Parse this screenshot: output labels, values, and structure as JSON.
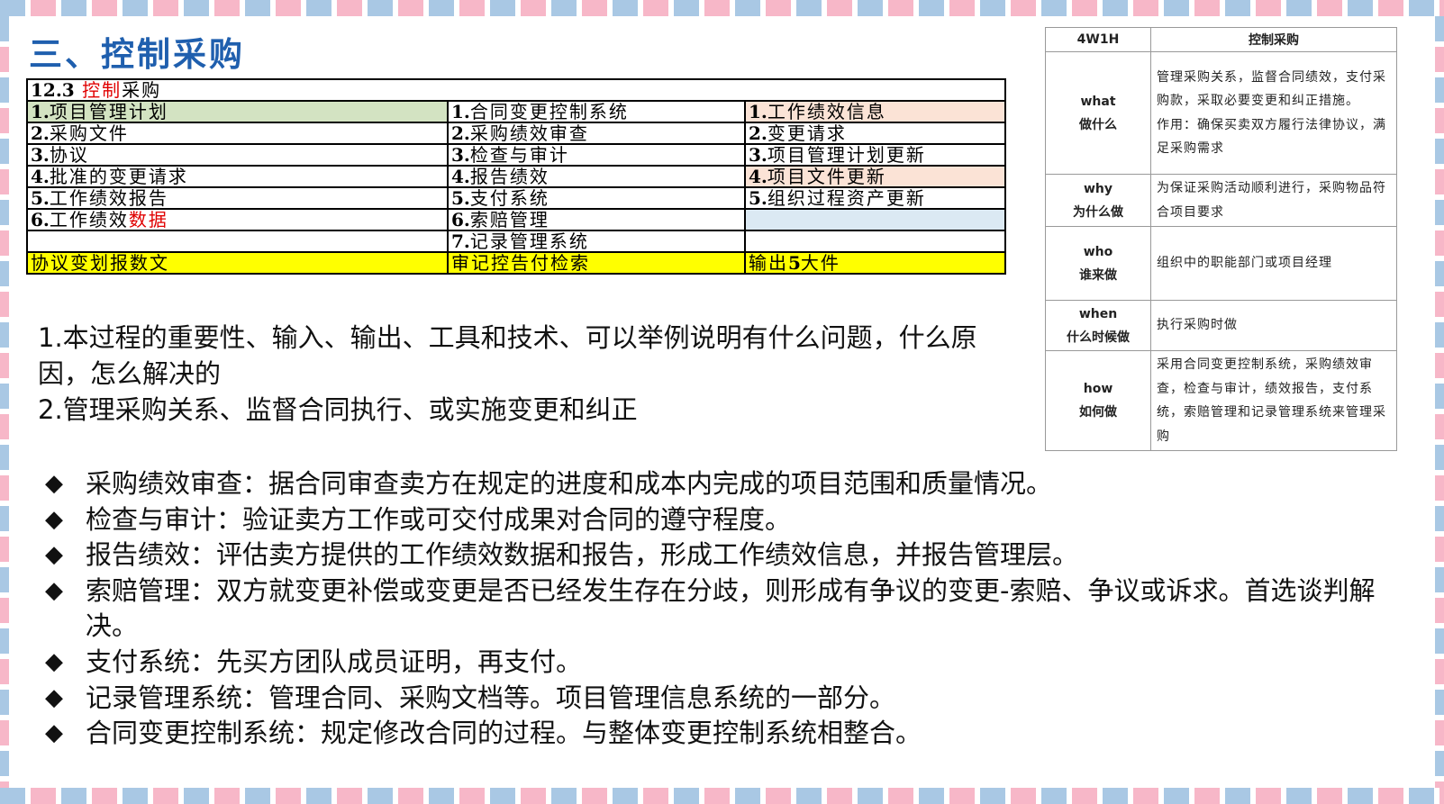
{
  "title": "三、控制采购",
  "process_table": {
    "heading_num": "12.3",
    "heading_red": "控制",
    "heading_rest": "采购",
    "rows": [
      {
        "c1n": "1.",
        "c1": "项目管理计划",
        "c2n": "1.",
        "c2": "合同变更控制系统",
        "c3n": "1.",
        "c3": "工作绩效信息"
      },
      {
        "c1n": "2.",
        "c1": "采购文件",
        "c2n": "2.",
        "c2": "采购绩效审查",
        "c3n": "2.",
        "c3": "变更请求"
      },
      {
        "c1n": "3.",
        "c1": "协议",
        "c2n": "3.",
        "c2": "检查与审计",
        "c3n": "3.",
        "c3": "项目管理计划更新"
      },
      {
        "c1n": "4.",
        "c1": "批准的变更请求",
        "c2n": "4.",
        "c2": "报告绩效",
        "c3n": "4.",
        "c3": "项目文件更新"
      },
      {
        "c1n": "5.",
        "c1": "工作绩效报告",
        "c2n": "5.",
        "c2": "支付系统",
        "c3n": "5.",
        "c3": "组织过程资产更新"
      },
      {
        "c1n": "6.",
        "c1": "工作绩效",
        "c1red": "数据",
        "c2n": "6.",
        "c2": "索赔管理",
        "c3n": "",
        "c3": ""
      },
      {
        "c1n": "",
        "c1": "",
        "c2n": "7.",
        "c2": "记录管理系统",
        "c3n": "",
        "c3": ""
      }
    ],
    "summary": {
      "c1": "协议变划报数文",
      "c2": "审记控告付检索",
      "c3a": "输出",
      "c3b": "5",
      "c3c": "大件"
    }
  },
  "para": {
    "line1": "1.本过程的重要性、输入、输出、工具和技术、可以举例说明有什么问题，什么原因，怎么解决的",
    "line2": "2.管理采购关系、监督合同执行、或实施变更和纠正"
  },
  "w4h": {
    "header_left": "4W1H",
    "header_right": "控制采购",
    "rows": [
      {
        "k1": "what",
        "k2": "做什么",
        "v1": "管理采购关系，监督合同绩效，支付采购款，采取必要变更和纠正措施。",
        "v2": "作用：确保买卖双方履行法律协议，满足采购需求"
      },
      {
        "k1": "why",
        "k2": "为什么做",
        "v1": "为保证采购活动顺利进行，采购物品符合项目要求",
        "v2": ""
      },
      {
        "k1": "who",
        "k2": "谁来做",
        "v1": "组织中的职能部门或项目经理",
        "v2": ""
      },
      {
        "k1": "when",
        "k2": "什么时候做",
        "v1": "执行采购时做",
        "v2": ""
      },
      {
        "k1": "how",
        "k2": "如何做",
        "v1": "采用合同变更控制系统，采购绩效审查，检查与审计，绩效报告，支付系统，索赔管理和记录管理系统来管理采购",
        "v2": ""
      }
    ]
  },
  "bullet_mark": "◆",
  "bullets": [
    "采购绩效审查：据合同审查卖方在规定的进度和成本内完成的项目范围和质量情况。",
    "检查与审计：验证卖方工作或可交付成果对合同的遵守程度。",
    "报告绩效：评估卖方提供的工作绩效数据和报告，形成工作绩效信息，并报告管理层。",
    "索赔管理：双方就变更补偿或变更是否已经发生存在分歧，则形成有争议的变更-索赔、争议或诉求。首选谈判解决。",
    "支付系统：先买方团队成员证明，再支付。",
    "记录管理系统：管理合同、采购文档等。项目管理信息系统的一部分。",
    "合同变更控制系统：规定修改合同的过程。与整体变更控制系统相整合。"
  ],
  "colors": {
    "title": "#1f5fae",
    "red": "#e00000",
    "yellow": "#ffff00",
    "green": "#d3e3c2",
    "peach": "#fbe3d6",
    "blue": "#dbe9f3"
  }
}
